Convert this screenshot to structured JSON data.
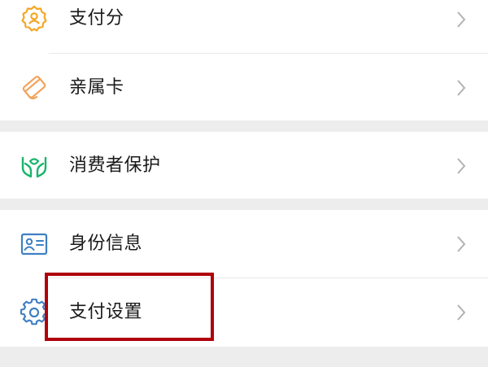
{
  "colors": {
    "page_background": "#ededed",
    "card_background": "#ffffff",
    "label_text": "#191919",
    "chevron": "#b2b2b2",
    "icon_yellow": "#f5a623",
    "icon_orange": "#f3a35b",
    "icon_green": "#19b46a",
    "icon_blue": "#3f7fc4",
    "highlight_border": "#b0000b"
  },
  "groups": [
    {
      "items": [
        {
          "label": "支付分",
          "icon": "payscore-badge-icon"
        },
        {
          "label": "亲属卡",
          "icon": "family-card-icon"
        }
      ]
    },
    {
      "items": [
        {
          "label": "消费者保护",
          "icon": "consumer-protection-hands-icon"
        }
      ]
    },
    {
      "items": [
        {
          "label": "身份信息",
          "icon": "id-card-icon"
        },
        {
          "label": "支付设置",
          "icon": "gear-icon",
          "highlighted": true
        }
      ]
    }
  ]
}
